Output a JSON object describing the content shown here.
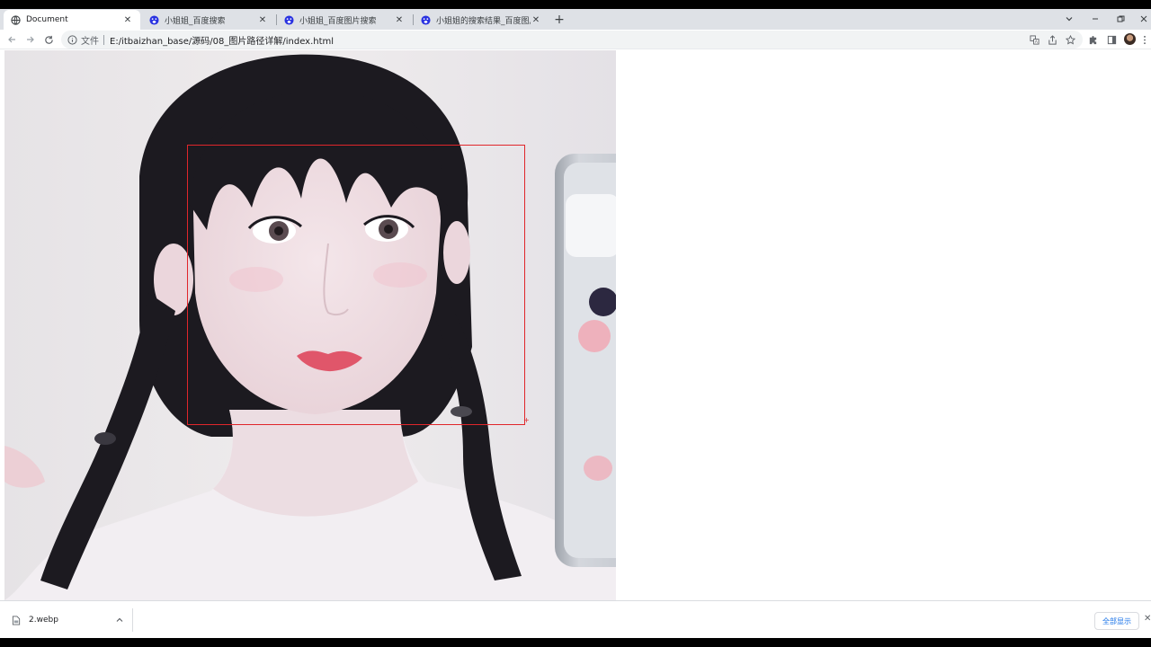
{
  "tabs": [
    {
      "title": "Document",
      "active": true
    },
    {
      "title": "小姐姐_百度搜索",
      "active": false
    },
    {
      "title": "小姐姐_百度图片搜索",
      "active": false
    },
    {
      "title": "小姐姐的搜索结果_百度图片搜索",
      "active": false
    }
  ],
  "toolbar": {
    "protocol_label": "文件",
    "url": "E:/itbaizhan_base/源码/08_图片路径详解/index.html"
  },
  "icons": {
    "back": "arrow-left",
    "forward": "arrow-right",
    "reload": "reload",
    "info": "info-circle",
    "translate": "translate",
    "share": "share",
    "bookmark": "star",
    "extensions": "puzzle",
    "sidepanel": "side-panel",
    "menu": "kebab-menu"
  },
  "page": {
    "image_alt": "",
    "highlight_color": "#e0262b"
  },
  "downloads": {
    "items": [
      {
        "name": "2.webp"
      }
    ],
    "show_all_label": "全部显示"
  },
  "colors": {
    "tabstrip": "#dee1e6",
    "accent": "#1a73e8"
  }
}
